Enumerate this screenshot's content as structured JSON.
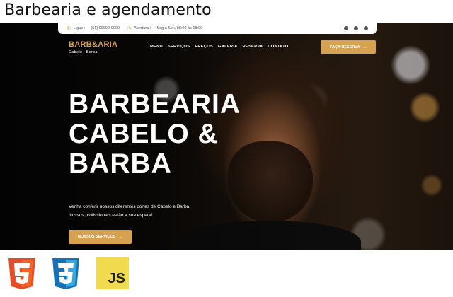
{
  "page_title": "Barbearia e agendamento",
  "topbar": {
    "phone_label": "Ligue :",
    "phone": "(51) 99999-9999",
    "hours_label": "Abertura :",
    "hours": "Seg a Sex, 08:00 às 18:00",
    "socials": [
      "facebook-icon",
      "instagram-icon",
      "whatsapp-icon"
    ]
  },
  "brand": {
    "name": "BARB&ARIA",
    "tagline": "Cabelo | Barba"
  },
  "nav": [
    "MENU",
    "SERVIÇOS",
    "PREÇOS",
    "GALERIA",
    "RESERVA",
    "CONTATO"
  ],
  "cta_top": {
    "label": "FAÇA RESERVA",
    "arrow": "→"
  },
  "hero": {
    "headline": [
      "BARBEARIA",
      "CABELO &",
      "BARBA"
    ],
    "sub1": "Venha conferir nossos diferentes cortes de Cabelo e Barba",
    "sub2": "Nossos profissionais estão a sua espera!",
    "cta_label": "NOSSOS SERVIÇOS",
    "cta_arrow": "→"
  },
  "badges": {
    "html_icon": "html5-icon",
    "css_icon": "css3-icon",
    "js_icon": "javascript-icon",
    "js_text": "JS"
  },
  "colors": {
    "accent": "#d6a24f",
    "dark": "#0a0a0a",
    "html": "#e44d26",
    "css": "#1572b6",
    "js": "#f0db4f"
  }
}
